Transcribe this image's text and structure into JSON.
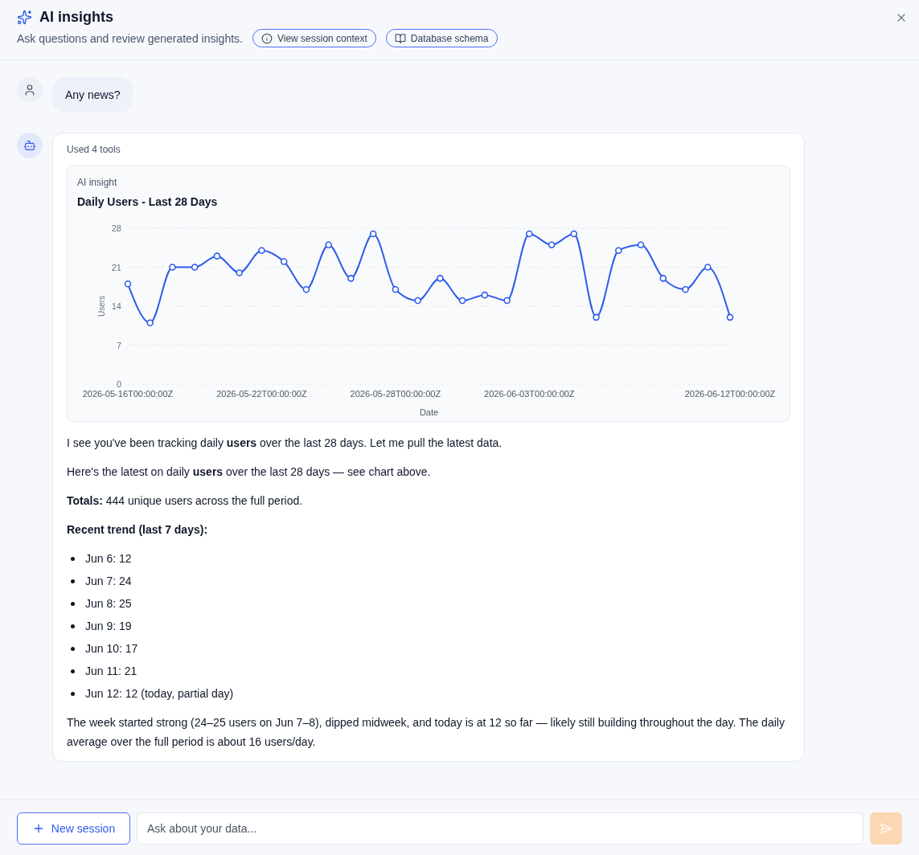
{
  "header": {
    "title": "AI insights",
    "subtitle": "Ask questions and review generated insights.",
    "buttons": [
      {
        "kind": "info",
        "label": "View session context"
      },
      {
        "kind": "book",
        "label": "Database schema"
      }
    ]
  },
  "messages": [
    {
      "kind": "user",
      "text": "Any news?"
    },
    {
      "kind": "assistant",
      "tools_note": "Used 4 tools",
      "insight": {
        "label": "AI insight",
        "chart_data": {
          "type": "line",
          "title": "Daily Users - Last 28 Days",
          "xlabel": "Date",
          "ylabel": "Users",
          "categories": [
            "2026-05-16T00:00:00Z",
            null,
            null,
            null,
            null,
            null,
            "2026-05-22T00:00:00Z",
            null,
            null,
            null,
            null,
            null,
            "2026-05-28T00:00:00Z",
            null,
            null,
            null,
            null,
            null,
            "2026-06-03T00:00:00Z",
            null,
            null,
            null,
            null,
            null,
            null,
            null,
            null,
            "2026-06-12T00:00:00Z"
          ],
          "series": [
            {
              "color": "#2f5ceb",
              "marker": "circle",
              "values": [
                18,
                11,
                21,
                21,
                23,
                20,
                24,
                22,
                17,
                25,
                19,
                27,
                17,
                15,
                19,
                15,
                16,
                15,
                27,
                25,
                27,
                12,
                24,
                25,
                19,
                17,
                21,
                12
              ]
            }
          ],
          "ylim": [
            0,
            28
          ],
          "yticks": [
            0,
            7,
            14,
            21,
            28
          ],
          "grid": true
        }
      },
      "blocks": [
        {
          "kind": "paragraph",
          "text": "I see you've been tracking daily **users** over the last 28 days. Let me pull the latest data."
        },
        {
          "kind": "paragraph",
          "text": "Here's the latest on daily **users** over the last 28 days — see chart above."
        },
        {
          "kind": "paragraph",
          "text": "**Totals:** 444 unique users across the full period."
        },
        {
          "kind": "heading",
          "text": "Recent trend (last 7 days):"
        },
        {
          "kind": "list",
          "items": [
            "Jun 6: 12",
            "Jun 7: 24",
            "Jun 8: 25",
            "Jun 9: 19",
            "Jun 10: 17",
            "Jun 11: 21",
            "Jun 12: 12 (today, partial day)"
          ]
        },
        {
          "kind": "paragraph",
          "text": "The week started strong (24–25 users on Jun 7–8), dipped midweek, and today is at 12 so far — likely still building throughout the day. The daily average over the full period is about 16 users/day."
        }
      ]
    }
  ],
  "composer": {
    "new_session": "New session",
    "placeholder": "Ask about your data...",
    "send_disabled": true
  }
}
